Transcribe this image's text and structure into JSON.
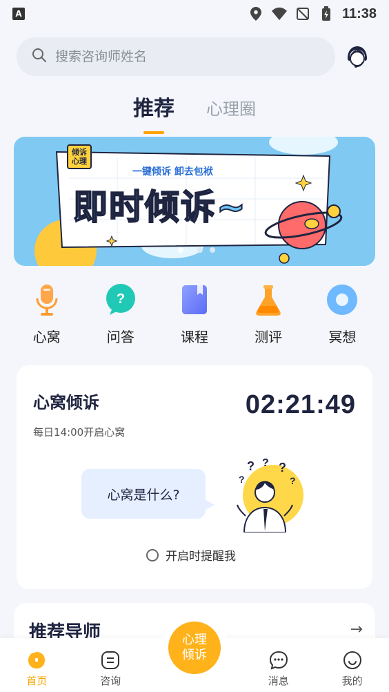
{
  "status": {
    "time": "11:38",
    "badge": "A"
  },
  "search": {
    "placeholder": "搜索咨询师姓名"
  },
  "tabs": [
    {
      "label": "推荐"
    },
    {
      "label": "心理圈"
    }
  ],
  "banner": {
    "tag": "倾诉心理",
    "subtitle": "一键倾诉 卸去包袱",
    "title": "即时倾诉~"
  },
  "quick_actions": [
    {
      "label": "心窝",
      "icon": "microphone-icon",
      "color": "#ff9c2e"
    },
    {
      "label": "问答",
      "icon": "qa-bubble-icon",
      "color": "#20c9b5"
    },
    {
      "label": "课程",
      "icon": "book-icon",
      "color": "#6b7cff"
    },
    {
      "label": "测评",
      "icon": "flask-icon",
      "color": "#ffa228"
    },
    {
      "label": "冥想",
      "icon": "meditation-icon",
      "color": "#4fa8ff"
    }
  ],
  "heart_card": {
    "title": "心窝倾诉",
    "subtitle": "每日14:00开启心窝",
    "countdown": "02:21:49",
    "bubble": "心窝是什么?",
    "remind": "开启时提醒我"
  },
  "mentors": {
    "title": "推荐导师",
    "arrow": "→"
  },
  "nav": {
    "items": [
      {
        "label": "首页",
        "icon": "home-icon"
      },
      {
        "label": "咨询",
        "icon": "consult-icon"
      },
      {
        "label": "消息",
        "icon": "message-icon"
      },
      {
        "label": "我的",
        "icon": "profile-icon"
      }
    ],
    "center": "心理倾诉"
  },
  "colors": {
    "accent": "#ffa200",
    "banner_bg": "#7fc9f2",
    "dark_text": "#1f2440"
  }
}
